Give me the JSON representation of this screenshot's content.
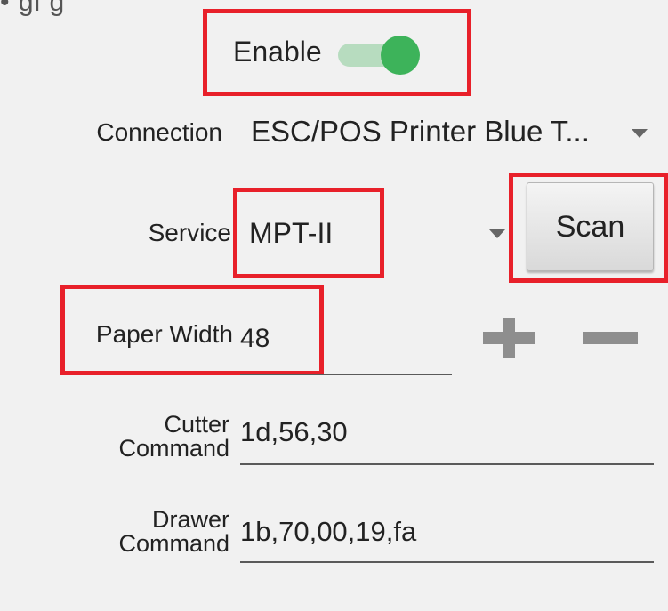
{
  "top_fragment": "• gi g",
  "enable": {
    "label": "Enable",
    "on": true,
    "track_color": "#b7dcbf",
    "thumb_color": "#3db35a"
  },
  "connection": {
    "label": "Connection",
    "value": "ESC/POS Printer Blue T..."
  },
  "service": {
    "label": "Service",
    "value": "MPT-II",
    "scan_label": "Scan"
  },
  "paper_width": {
    "label": "Paper Width",
    "value": "48",
    "increment_icon": "plus-icon",
    "decrement_icon": "minus-icon"
  },
  "cutter": {
    "label_line1": "Cutter",
    "label_line2": "Command",
    "value": "1d,56,30"
  },
  "drawer": {
    "label_line1": "Drawer",
    "label_line2": "Command",
    "value": "1b,70,00,19,fa"
  },
  "highlight_color": "#e8202a"
}
